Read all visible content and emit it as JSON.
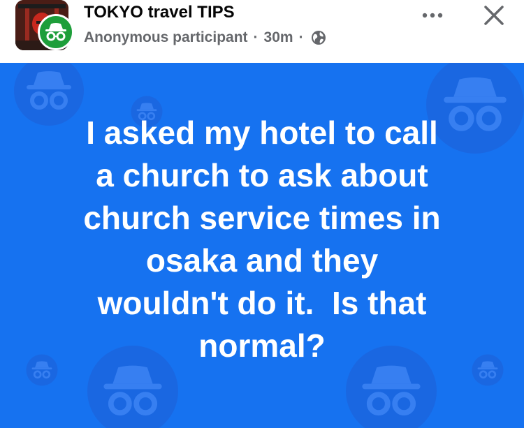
{
  "header": {
    "group_name": "TOKYO travel TIPS",
    "author": "Anonymous participant",
    "separator": "·",
    "time": "30m",
    "audience_icon": "globe-icon",
    "more_icon": "more-dots-icon",
    "close_icon": "close-icon",
    "group_avatar": "group-avatar-image",
    "user_avatar_icon": "anonymous-incognito-icon"
  },
  "post": {
    "background_color": "#1672f0",
    "pattern_icon": "anonymous-incognito-icon",
    "lines": [
      "I asked my hotel to call",
      "a church to ask about",
      "church service times in",
      "osaka and they",
      "wouldn't do it.  Is that",
      "normal?"
    ]
  }
}
